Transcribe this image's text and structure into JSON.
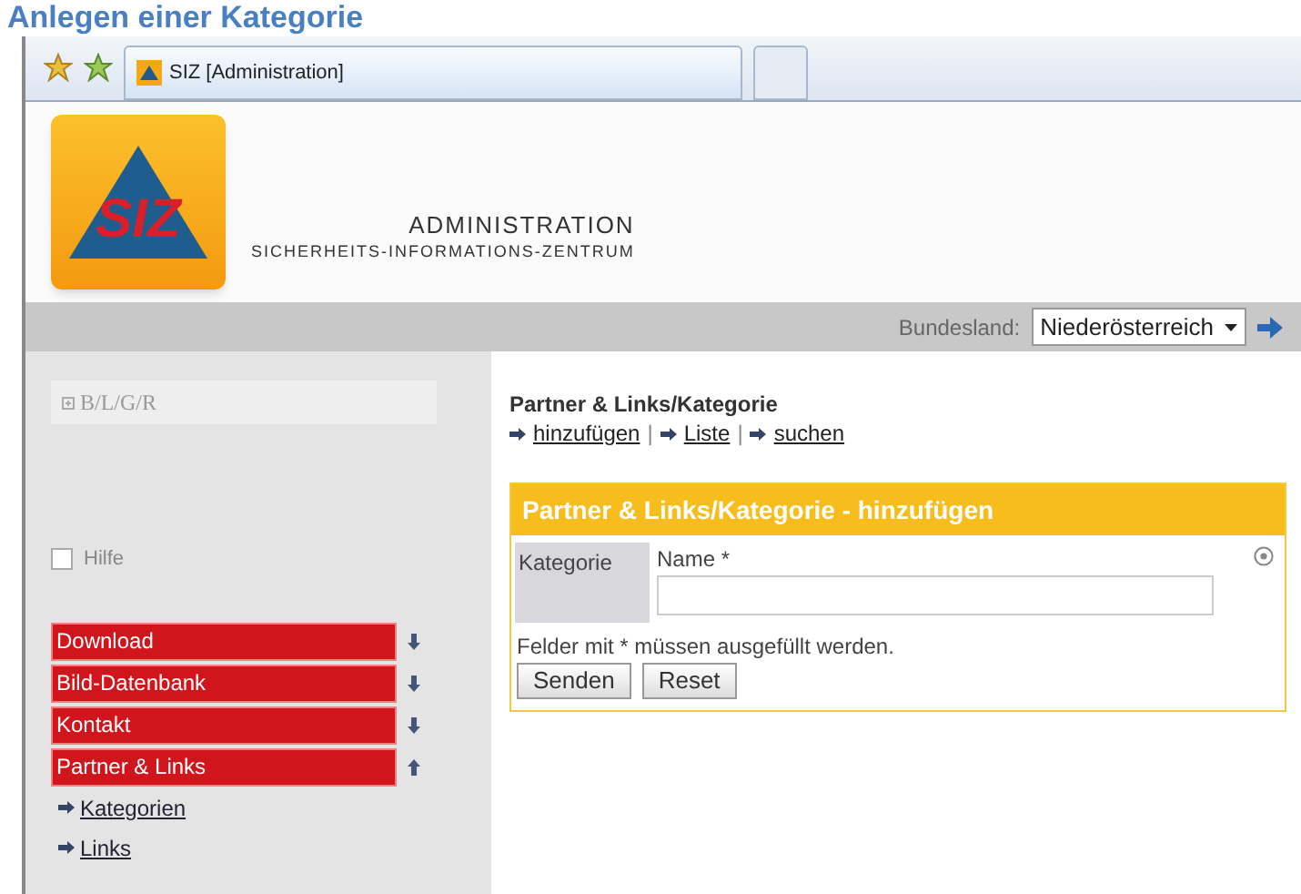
{
  "slide_title": "Anlegen einer Kategorie",
  "browser": {
    "tab_title": "SIZ [Administration]"
  },
  "header": {
    "logo": "SIZ",
    "subtitle": "ADMINISTRATION",
    "tagline": "SICHERHEITS-INFORMATIONS-ZENTRUM"
  },
  "region_bar": {
    "label": "Bundesland:",
    "value": "Niederösterreich"
  },
  "sidebar": {
    "tree_root": "B/L/G/R",
    "help": {
      "label": "Hilfe",
      "checked": false
    },
    "menu": [
      {
        "label": "Download",
        "expanded": false
      },
      {
        "label": "Bild-Datenbank",
        "expanded": false
      },
      {
        "label": "Kontakt",
        "expanded": false
      },
      {
        "label": "Partner & Links",
        "expanded": true,
        "children": [
          {
            "label": "Kategorien"
          },
          {
            "label": "Links"
          }
        ]
      }
    ]
  },
  "content": {
    "breadcrumb": "Partner & Links/Kategorie",
    "actions": [
      "hinzufügen",
      "Liste",
      "suchen"
    ],
    "action_separator": "|",
    "form": {
      "title": "Partner & Links/Kategorie - hinzufügen",
      "section": "Kategorie",
      "field_label": "Name *",
      "note": "Felder mit * müssen ausgefüllt werden.",
      "buttons": [
        "Senden",
        "Reset"
      ]
    }
  }
}
